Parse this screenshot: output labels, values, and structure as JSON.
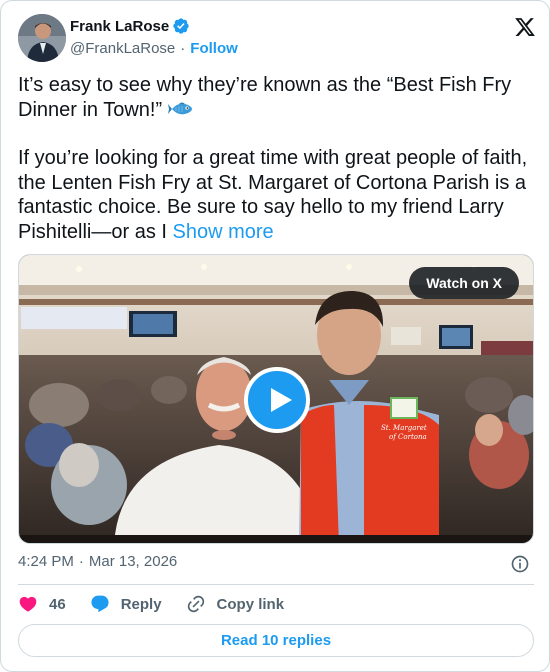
{
  "author": {
    "name": "Frank LaRose",
    "handle": "@FrankLaRose",
    "follow_label": "Follow"
  },
  "post": {
    "line1": "It’s easy to see why they’re known as the “Best Fish Fry Dinner in Town!”",
    "paragraph2": "If you’re looking for a great time with great people of faith, the Lenten Fish Fry at St. Margaret of Cortona Parish is a fantastic choice. Be sure to say hello to my friend Larry Pishitelli—or as I",
    "show_more_label": "Show more"
  },
  "media": {
    "watch_label": "Watch on X",
    "vest_text_line1": "St. Margaret",
    "vest_text_line2": "of Cortona"
  },
  "meta": {
    "time": "4:24 PM",
    "date": "Mar 13, 2026"
  },
  "actions": {
    "like_count": "46",
    "reply_label": "Reply",
    "copy_link_label": "Copy link"
  },
  "footer": {
    "read_replies_label": "Read 10 replies"
  },
  "colors": {
    "accent": "#1d9bf0",
    "like": "#f91880",
    "text": "#0f1419",
    "muted": "#536471"
  },
  "icons": [
    "verified-badge-icon",
    "x-logo-icon",
    "fish-emoji-icon",
    "play-icon",
    "info-icon",
    "heart-icon",
    "reply-bubble-icon",
    "link-icon"
  ]
}
